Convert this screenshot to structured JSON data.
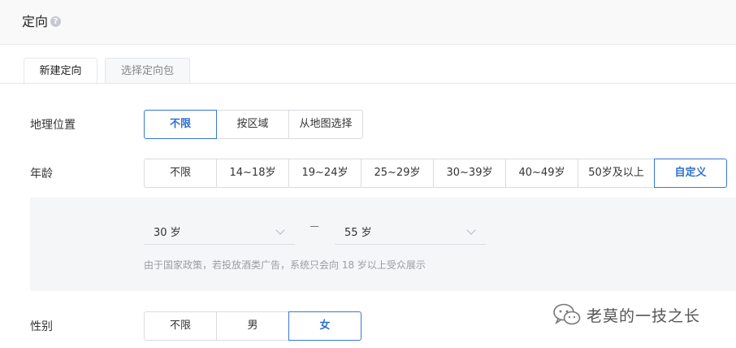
{
  "header": {
    "title": "定向",
    "help_glyph": "?"
  },
  "tabs": [
    {
      "label": "新建定向",
      "active": true
    },
    {
      "label": "选择定向包",
      "active": false
    }
  ],
  "location": {
    "label": "地理位置",
    "options": [
      "不限",
      "按区域",
      "从地图选择"
    ],
    "selected": "不限"
  },
  "age": {
    "label": "年龄",
    "options": [
      "不限",
      "14~18岁",
      "19~24岁",
      "25~29岁",
      "30~39岁",
      "40~49岁",
      "50岁及以上",
      "自定义"
    ],
    "selected": "自定义",
    "custom": {
      "min_value": "30 岁",
      "max_value": "55 岁",
      "notice": "由于国家政策，若投放酒类广告，系统只会向 18 岁以上受众展示"
    }
  },
  "gender": {
    "label": "性别",
    "options": [
      "不限",
      "男",
      "女"
    ],
    "selected": "女"
  },
  "watermark": {
    "text": "老莫的一技之长"
  },
  "colors": {
    "accent": "#3778d7",
    "panel_bg": "#f5f6f8",
    "header_bg": "#f9f9fa"
  }
}
